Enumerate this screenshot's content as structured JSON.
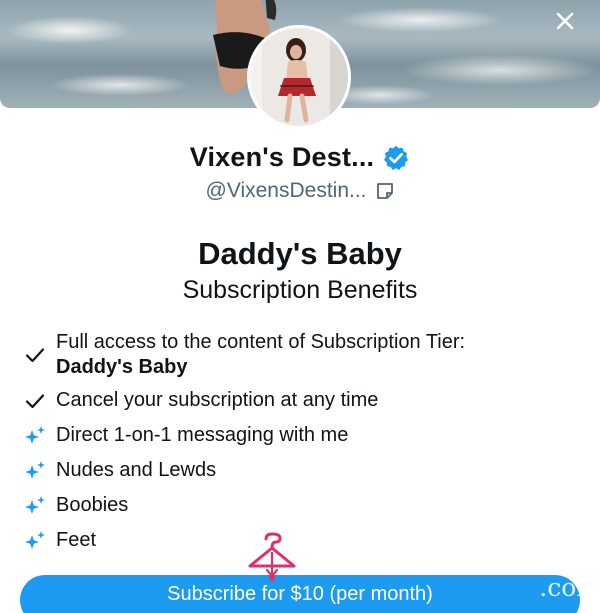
{
  "header": {
    "close_icon": "close-icon"
  },
  "profile": {
    "display_name": "Vixen's Dest...",
    "handle": "@VixensDestin...",
    "verified_icon": "verified-badge-icon",
    "note_icon": "note-icon"
  },
  "tier": {
    "name": "Daddy's Baby",
    "subtitle": "Subscription Benefits"
  },
  "benefits": [
    {
      "icon": "check-icon",
      "text": "Full access to the content of Subscription Tier:",
      "bold": "Daddy's Baby"
    },
    {
      "icon": "check-icon",
      "text": "Cancel your subscription at any time"
    },
    {
      "icon": "sparkle-icon",
      "text": "Direct 1-on-1 messaging with me"
    },
    {
      "icon": "sparkle-icon",
      "text": "Nudes and Lewds"
    },
    {
      "icon": "sparkle-icon",
      "text": "Boobies"
    },
    {
      "icon": "sparkle-icon",
      "text": "Feet"
    }
  ],
  "subscribe": {
    "label": "Subscribe for $10 (per month)"
  },
  "watermark": {
    "text": ".com",
    "icon": "hanger-icon"
  },
  "colors": {
    "accent": "#1d9bf0",
    "sparkle": "#1d9bf0",
    "watermark": "#e0306a"
  }
}
